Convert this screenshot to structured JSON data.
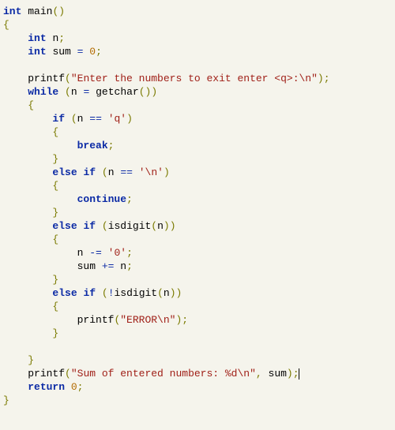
{
  "code": {
    "kw_int": "int",
    "kw_while": "while",
    "kw_if": "if",
    "kw_else": "else",
    "kw_break": "break",
    "kw_continue": "continue",
    "kw_return": "return",
    "id_main": "main",
    "id_n": "n",
    "id_sum": "sum",
    "id_printf": "printf",
    "id_getchar": "getchar",
    "id_isdigit": "isdigit",
    "num_0": "0",
    "str_prompt": "\"Enter the numbers to exit enter <q>:\\n\"",
    "str_error": "\"ERROR\\n\"",
    "str_sumfmt": "\"Sum of entered numbers: %d\\n\"",
    "chr_q": "'q'",
    "chr_nl": "'\\n'",
    "chr_0": "'0'",
    "op_assign": "=",
    "op_eq": "==",
    "op_noteq_bang": "!",
    "op_minuseq": "-=",
    "op_pluseq": "+=",
    "pn_open_paren": "(",
    "pn_close_paren": ")",
    "pn_open_brace": "{",
    "pn_close_brace": "}",
    "pn_semi": ";",
    "pn_comma": ","
  }
}
